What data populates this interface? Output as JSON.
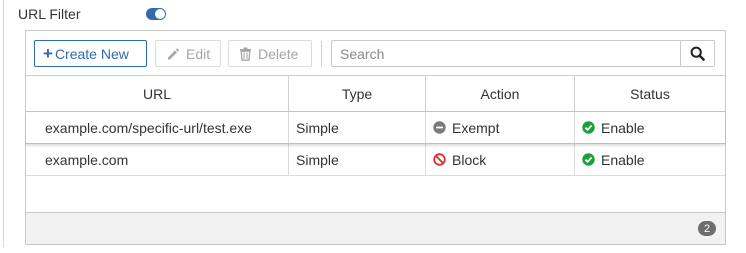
{
  "url_filter": {
    "label": "URL Filter",
    "enabled": true
  },
  "toolbar": {
    "create_label": "Create New",
    "edit_label": "Edit",
    "delete_label": "Delete",
    "search_placeholder": "Search"
  },
  "table": {
    "columns": [
      "URL",
      "Type",
      "Action",
      "Status"
    ],
    "rows": [
      {
        "url": "example.com/specific-url/test.exe",
        "type": "Simple",
        "action": "Exempt",
        "action_icon": "minus-circle-icon",
        "status": "Enable",
        "status_icon": "check-circle-icon"
      },
      {
        "url": "example.com",
        "type": "Simple",
        "action": "Block",
        "action_icon": "block-icon",
        "status": "Enable",
        "status_icon": "check-circle-icon"
      }
    ]
  },
  "footer": {
    "count": "2"
  },
  "colors": {
    "accent": "#2f6aad",
    "enable_green": "#1e9e3e",
    "block_red": "#d9312b",
    "exempt_gray": "#7a7a7a"
  }
}
